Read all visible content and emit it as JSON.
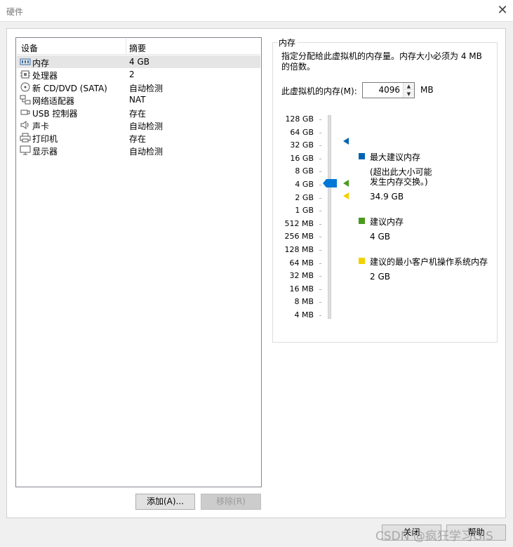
{
  "window": {
    "title": "硬件",
    "close_glyph": "✕"
  },
  "device_list": {
    "headers": {
      "device": "设备",
      "summary": "摘要"
    },
    "rows": [
      {
        "name": "内存",
        "summary": "4 GB",
        "icon": "memory-icon"
      },
      {
        "name": "处理器",
        "summary": "2",
        "icon": "processor-icon"
      },
      {
        "name": "新 CD/DVD (SATA)",
        "summary": "自动检测",
        "icon": "cd-dvd-icon"
      },
      {
        "name": "网络适配器",
        "summary": "NAT",
        "icon": "network-adapter-icon"
      },
      {
        "name": "USB 控制器",
        "summary": "存在",
        "icon": "usb-icon"
      },
      {
        "name": "声卡",
        "summary": "自动检测",
        "icon": "speaker-icon"
      },
      {
        "name": "打印机",
        "summary": "存在",
        "icon": "printer-icon"
      },
      {
        "name": "显示器",
        "summary": "自动检测",
        "icon": "monitor-icon"
      }
    ],
    "selected_index": 0
  },
  "list_buttons": {
    "add": "添加(A)...",
    "remove": "移除(R)"
  },
  "memory": {
    "group_title": "内存",
    "description": "指定分配给此虚拟机的内存量。内存大小必须为 4 MB 的倍数。",
    "field_label": "此虚拟机的内存(M):",
    "value": "4096",
    "unit": "MB",
    "scale": [
      "128 GB",
      "64 GB",
      "32 GB",
      "16 GB",
      "8 GB",
      "4 GB",
      "2 GB",
      "1 GB",
      "512 MB",
      "256 MB",
      "128 MB",
      "64 MB",
      "32 MB",
      "16 MB",
      "8 MB",
      "4 MB"
    ],
    "legend": {
      "max": {
        "label": "最大建议内存",
        "note": "(超出此大小可能\n发生内存交换。)",
        "value": "34.9 GB",
        "color": "#0063b1"
      },
      "recommended": {
        "label": "建议内存",
        "value": "4 GB",
        "color": "#4b9a1e"
      },
      "min": {
        "label": "建议的最小客户机操作系统内存",
        "value": "2 GB",
        "color": "#f2d100"
      }
    }
  },
  "dialog_buttons": {
    "close": "关闭",
    "help": "帮助"
  },
  "watermark": "CSDN @疯狂学习GIS"
}
